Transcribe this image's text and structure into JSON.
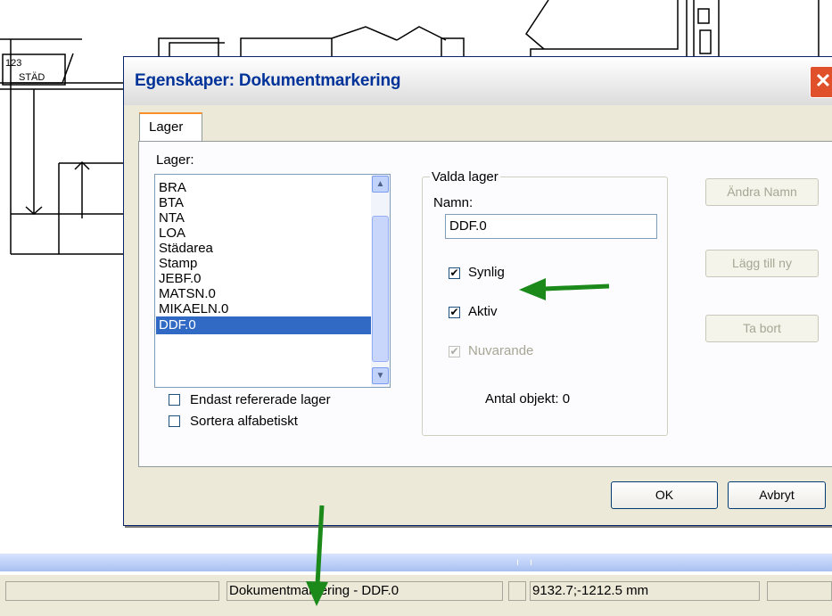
{
  "background": {
    "room_number": "123",
    "room_name": "STÄD"
  },
  "dialog": {
    "title": "Egenskaper: Dokumentmarkering",
    "close_glyph": "✕",
    "tab_label": "Lager",
    "layers_label": "Lager:",
    "layers": [
      "BRA",
      "BTA",
      "NTA",
      "LOA",
      "Städarea",
      "Stamp",
      "JEBF.0",
      "MATSN.0",
      "MIKAELN.0",
      "DDF.0"
    ],
    "selected_layer": "DDF.0",
    "only_referenced_label": "Endast refererade lager",
    "only_referenced_checked": false,
    "sort_alpha_label": "Sortera alfabetiskt",
    "sort_alpha_checked": false,
    "selected_group_legend": "Valda lager",
    "name_label": "Namn:",
    "name_value": "DDF.0",
    "visible_label": "Synlig",
    "visible_checked": true,
    "active_label": "Aktiv",
    "active_checked": true,
    "current_label": "Nuvarande",
    "current_checked": true,
    "object_count_label": "Antal objekt: 0",
    "rename_button": "Ändra Namn",
    "add_new_button": "Lägg till ny",
    "remove_button": "Ta bort",
    "ok_button": "OK",
    "cancel_button": "Avbryt"
  },
  "statusbar": {
    "mode_text": "Dokumentmarkering - DDF.0",
    "coords_text": "9132.7;-1212.5 mm"
  },
  "colors": {
    "title_text": "#003399",
    "selection": "#316ac5",
    "arrow": "#1b8a1b",
    "close_button": "#e0502b"
  }
}
